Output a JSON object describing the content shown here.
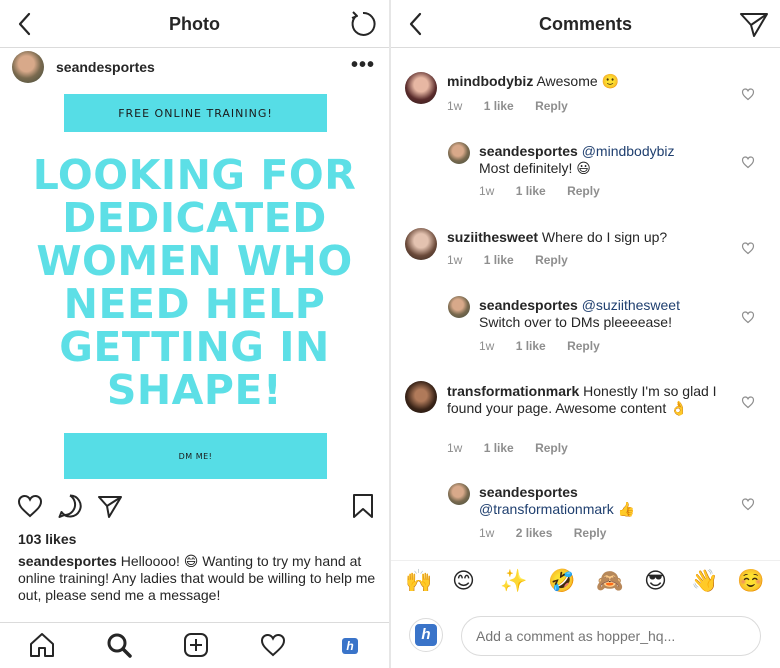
{
  "left_panel": {
    "header": {
      "title": "Photo"
    },
    "post": {
      "username": "seandesportes",
      "more_label": "•••",
      "image": {
        "top_banner": "FREE ONLINE TRAINING!",
        "headline": "LOOKING FOR DEDICATED WOMEN WHO NEED HELP GETTING IN SHAPE!",
        "bottom_banner": "DM ME!",
        "accent_color": "#5ddfe6"
      },
      "likes": "103 likes",
      "caption_user": "seandesportes",
      "caption_text": "Helloooo! 😄 Wanting to try my hand at online training! Any ladies that would be willing to help me out, please send me a message!"
    },
    "bottom_nav": [
      "home-icon",
      "search-icon",
      "add-icon",
      "heart-icon",
      "profile-icon"
    ],
    "profile_badge": "h"
  },
  "right_panel": {
    "header": {
      "title": "Comments"
    },
    "comments": [
      {
        "user": "mindbodybiz",
        "mention": "",
        "text": "Awesome 🙂",
        "time": "1w",
        "likes": "1 like",
        "reply": "Reply"
      },
      {
        "user": "seandesportes",
        "mention": "@mindbodybiz",
        "text": "Most definitely! 😃",
        "time": "1w",
        "likes": "1 like",
        "reply": "Reply"
      },
      {
        "user": "suziithesweet",
        "mention": "",
        "text": "Where do I sign up?",
        "time": "1w",
        "likes": "1 like",
        "reply": "Reply"
      },
      {
        "user": "seandesportes",
        "mention": "@suziithesweet",
        "text": "Switch over to DMs pleeeease!",
        "time": "1w",
        "likes": "1 like",
        "reply": "Reply"
      },
      {
        "user": "transformationmark",
        "mention": "",
        "text": "Honestly I'm so glad I found your page. Awesome content 👌",
        "time": "1w",
        "likes": "1 like",
        "reply": "Reply"
      },
      {
        "user": "seandesportes",
        "mention": "@transformationmark",
        "text": "👍",
        "time": "1w",
        "likes": "2 likes",
        "reply": "Reply"
      }
    ],
    "emojis": [
      "🙌",
      "😊",
      "✨",
      "🤣",
      "🙈",
      "😎",
      "👋",
      "☺️"
    ],
    "comment_box": {
      "placeholder": "Add a comment as hopper_hq...",
      "badge": "h"
    }
  }
}
